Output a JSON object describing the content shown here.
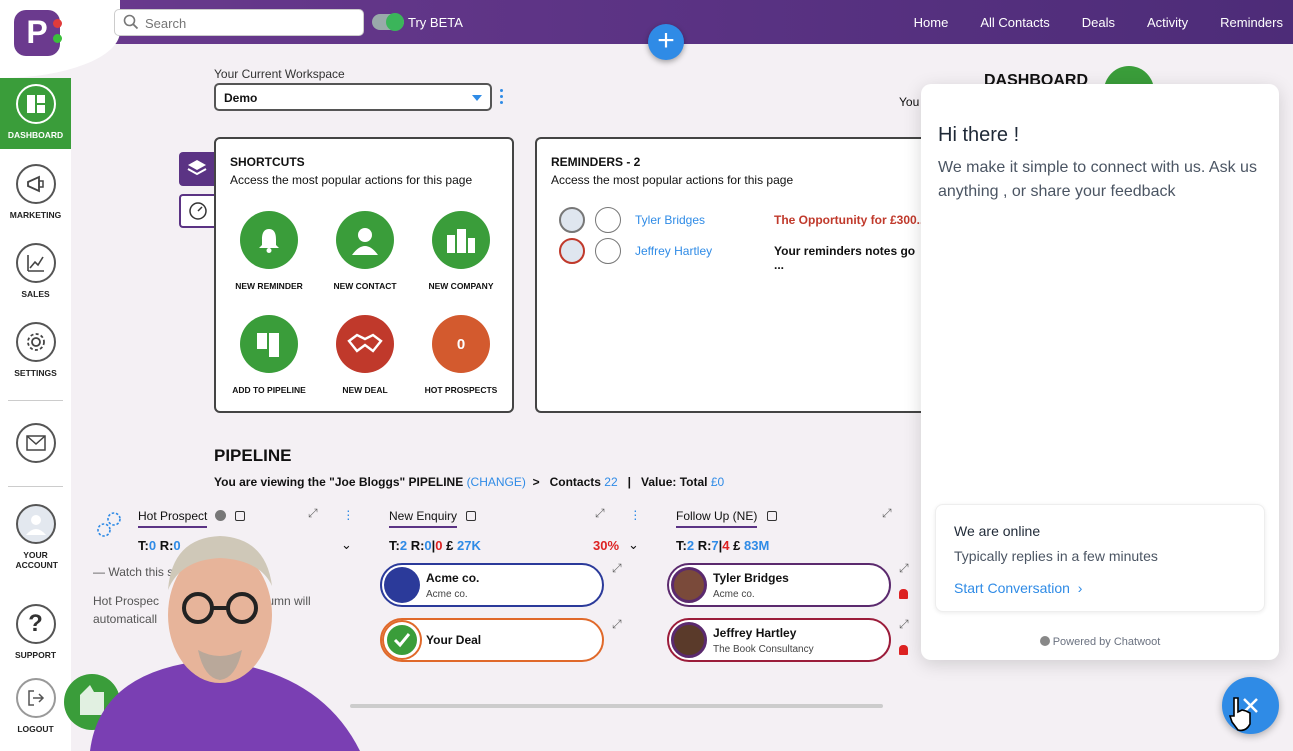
{
  "topbar": {
    "search_placeholder": "Search",
    "beta_label": "Try BETA",
    "nav": [
      "Home",
      "All Contacts",
      "Deals",
      "Activity",
      "Reminders"
    ]
  },
  "sidebar": {
    "items": [
      {
        "label": "DASHBOARD",
        "icon": "dashboard-icon"
      },
      {
        "label": "MARKETING",
        "icon": "megaphone-icon"
      },
      {
        "label": "SALES",
        "icon": "chart-icon"
      },
      {
        "label": "SETTINGS",
        "icon": "gear-icon"
      },
      {
        "label": "",
        "icon": "mail-icon"
      },
      {
        "label": "YOUR ACCOUNT",
        "icon": "avatar-icon"
      },
      {
        "label": "SUPPORT",
        "icon": "help-icon"
      },
      {
        "label": "LOGOUT",
        "icon": "logout-icon"
      }
    ]
  },
  "workspace": {
    "label": "Your Current Workspace",
    "value": "Demo"
  },
  "dashboard": {
    "title": "DASHBOARD",
    "you_text": "You"
  },
  "shortcuts": {
    "title": "SHORTCUTS",
    "subtitle": "Access the most popular actions for this page",
    "items": [
      {
        "label": "NEW REMINDER",
        "color": "#3a9d3a"
      },
      {
        "label": "NEW CONTACT",
        "color": "#3a9d3a"
      },
      {
        "label": "NEW COMPANY",
        "color": "#3a9d3a"
      },
      {
        "label": "ADD TO PIPELINE",
        "color": "#3a9d3a"
      },
      {
        "label": "NEW DEAL",
        "color": "#c0392b"
      },
      {
        "label": "HOT PROSPECTS",
        "color": "#d35a2e",
        "count": "0"
      }
    ]
  },
  "reminders": {
    "title": "REMINDERS - 2",
    "subtitle": "Access the most popular actions for this page",
    "rows": [
      {
        "name": "Tyler Bridges",
        "message": "The Opportunity for £300...",
        "message_color": "#c0392b"
      },
      {
        "name": "Jeffrey Hartley",
        "message": "Your reminders notes go ...",
        "message_color": "#111111"
      }
    ]
  },
  "pipeline": {
    "title": "PIPELINE",
    "viewing_prefix": "You are viewing the \"Joe Bloggs\" PIPELINE",
    "change_label": "(CHANGE)",
    "contacts_label": "Contacts",
    "contacts_count": "22",
    "value_label": "Value: Total",
    "value_total": "£0",
    "columns": [
      {
        "name": "Hot Prospect",
        "t": "0",
        "r": "0",
        "hint1": "— Watch this s",
        "hint2": "Hot Prospec",
        "hint2b": "olumn will",
        "hint3": "automaticall"
      },
      {
        "name": "New Enquiry",
        "t": "2",
        "r": "0",
        "r2": "0",
        "value": "27K",
        "pct": "30%"
      },
      {
        "name": "Follow Up (NE)",
        "t": "2",
        "r": "7",
        "r2": "4",
        "value": "83M"
      }
    ],
    "deals": [
      {
        "title": "Acme co.",
        "subtitle": "Acme co.",
        "border": "#2b3a9a"
      },
      {
        "title": "Your Deal",
        "subtitle": "",
        "border": "#e0692a"
      },
      {
        "title": "Tyler Bridges",
        "subtitle": "Acme co.",
        "border": "#5b2a6e"
      },
      {
        "title": "Jeffrey Hartley",
        "subtitle": "The Book Consultancy",
        "border": "#9b1c3a"
      }
    ]
  },
  "chat": {
    "greeting": "Hi there !",
    "description": "We make it simple to connect with us. Ask us anything , or share your feedback",
    "online": "We are online",
    "reply_time": "Typically replies in a few minutes",
    "start": "Start Conversation",
    "powered": "Powered by Chatwoot"
  }
}
